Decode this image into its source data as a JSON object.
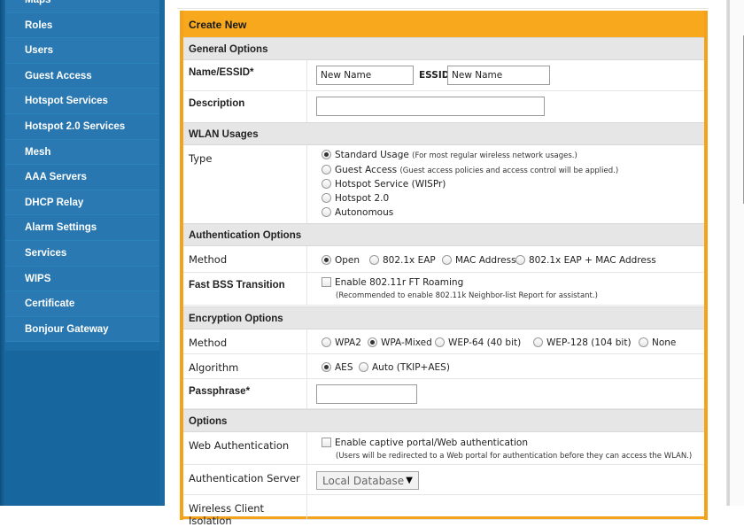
{
  "sidebar": {
    "items": [
      {
        "label": "Maps"
      },
      {
        "label": "Roles"
      },
      {
        "label": "Users"
      },
      {
        "label": "Guest Access"
      },
      {
        "label": "Hotspot Services"
      },
      {
        "label": "Hotspot 2.0 Services"
      },
      {
        "label": "Mesh"
      },
      {
        "label": "AAA Servers"
      },
      {
        "label": "DHCP Relay"
      },
      {
        "label": "Alarm Settings"
      },
      {
        "label": "Services"
      },
      {
        "label": "WIPS"
      },
      {
        "label": "Certificate"
      },
      {
        "label": "Bonjour Gateway"
      }
    ]
  },
  "panel": {
    "title": "Create New",
    "general": {
      "header": "General Options",
      "name_label": "Name/ESSID*",
      "name_value": "New Name",
      "essid_label": "ESSID",
      "essid_value": "New Name",
      "description_label": "Description",
      "description_value": ""
    },
    "usage": {
      "header": "WLAN Usages",
      "type_label": "Type",
      "options": [
        {
          "label": "Standard Usage",
          "note": "(For most regular wireless network usages.)",
          "selected": true
        },
        {
          "label": "Guest Access",
          "note": "(Guest access policies and access control will be applied.)",
          "selected": false
        },
        {
          "label": "Hotspot Service (WISPr)",
          "note": "",
          "selected": false
        },
        {
          "label": "Hotspot 2.0",
          "note": "",
          "selected": false
        },
        {
          "label": "Autonomous",
          "note": "",
          "selected": false
        }
      ]
    },
    "auth": {
      "header": "Authentication Options",
      "method_label": "Method",
      "methods": [
        {
          "label": "Open",
          "selected": true
        },
        {
          "label": "802.1x EAP",
          "selected": false
        },
        {
          "label": "MAC Address",
          "selected": false
        },
        {
          "label": "802.1x EAP + MAC Address",
          "selected": false
        }
      ],
      "fbt_label": "Fast BSS Transition",
      "fbt_checkbox": "Enable 802.11r FT Roaming",
      "fbt_note": "(Recommended to enable 802.11k Neighbor-list Report for assistant.)"
    },
    "encryption": {
      "header": "Encryption Options",
      "method_label": "Method",
      "methods": [
        {
          "label": "WPA2",
          "selected": false
        },
        {
          "label": "WPA-Mixed",
          "selected": true
        },
        {
          "label": "WEP-64 (40 bit)",
          "selected": false
        },
        {
          "label": "WEP-128 (104 bit)",
          "selected": false
        },
        {
          "label": "None",
          "selected": false
        }
      ],
      "algorithm_label": "Algorithm",
      "algorithms": [
        {
          "label": "AES",
          "selected": true
        },
        {
          "label": "Auto (TKIP+AES)",
          "selected": false
        }
      ],
      "passphrase_label": "Passphrase*",
      "passphrase_value": ""
    },
    "options": {
      "header": "Options",
      "web_auth_label": "Web Authentication",
      "web_auth_checkbox": "Enable captive portal/Web authentication",
      "web_auth_note": "(Users will be redirected to a Web portal for authentication before they can access the WLAN.)",
      "auth_server_label": "Authentication Server",
      "auth_server_value": "Local Database",
      "isolation_label": "Wireless Client Isolation"
    }
  },
  "colors": {
    "sidebar": "#1d6ea6",
    "panel_border": "#f5a21b",
    "section_bg": "#e6e6e6"
  }
}
